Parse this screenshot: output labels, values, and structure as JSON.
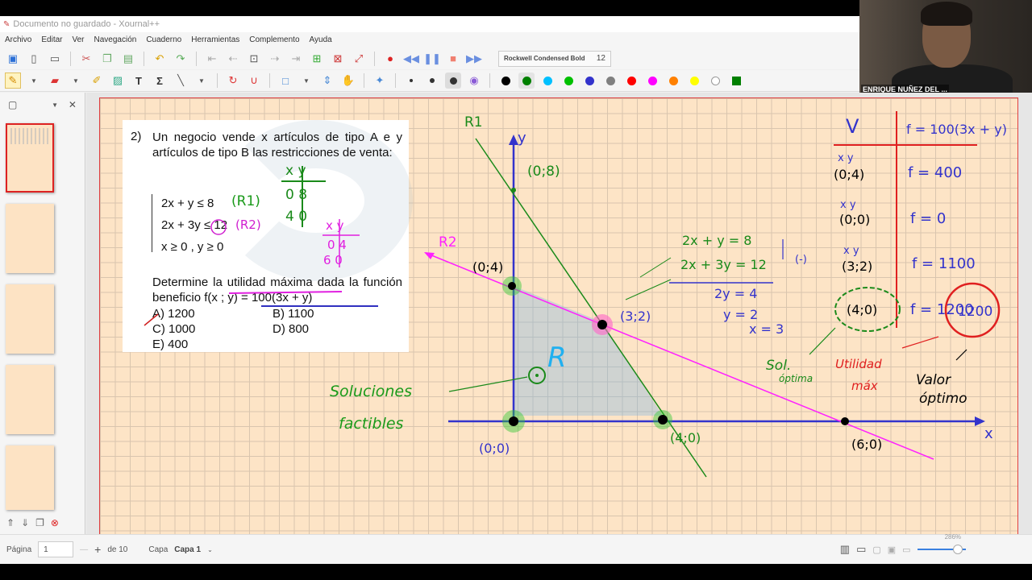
{
  "window": {
    "title": "Documento no guardado - Xournal++"
  },
  "menu": [
    "Archivo",
    "Editar",
    "Ver",
    "Navegación",
    "Cuaderno",
    "Herramientas",
    "Complemento",
    "Ayuda"
  ],
  "toolbar": {
    "font_name": "Rockwell Condensed Bold",
    "font_size": "12"
  },
  "palette": [
    "#000000",
    "#008000",
    "#00c0ff",
    "#00c000",
    "#3333cc",
    "#808080",
    "#ff0000",
    "#ff00ff",
    "#ff8000",
    "#ffff00",
    "#ffffff",
    "#008000"
  ],
  "webcam": {
    "name": "ENRIQUE NUÑEZ DEL ..."
  },
  "problem": {
    "number": "2)",
    "statement": "Un negocio vende x artículos de tipo A e y artículos de tipo B las restricciones de venta:",
    "c1": "2x + y ≤ 8",
    "c2": "2x + 3y ≤ 12",
    "c3": "x ≥ 0 , y ≥ 0",
    "question": "Determine la utilidad máxima dada la función beneficio f(x ; y) = 100(3x + y)",
    "opt_a": "A) 1200",
    "opt_b": "B) 1100",
    "opt_c": "C) 1000",
    "opt_d": "D) 800",
    "opt_e": "E) 400"
  },
  "notes": {
    "r1_label": "R1",
    "r2_label": "R2",
    "r1_tag": "(R1)",
    "r2_tag": "(R2)",
    "y_axis": "y",
    "x_axis": "x",
    "t1_head": "x  y",
    "t1_r1": "0  8",
    "t1_r2": "4  0",
    "t2_head": "x  y",
    "t2_r1": "0  4",
    "t2_r2": "6  0",
    "p08": "(0;8)",
    "p04": "(0;4)",
    "p32": "(3;2)",
    "p00": "(0;0)",
    "p40": "(4;0)",
    "p60": "(6;0)",
    "region": "R",
    "feasible1": "Soluciones",
    "feasible2": "factibles",
    "eq1": "2x + y = 8",
    "eq2": "2x + 3y = 12",
    "eq_op": "(-)",
    "eq3": "2y = 4",
    "eq4": "y = 2",
    "eq5": "x = 3",
    "sol1": "Sol.",
    "sol2": "óptima",
    "util1": "Utilidad",
    "util2": "máx",
    "valor1": "Valor",
    "valor2": "óptimo",
    "tbl_v": "V",
    "tbl_f": "f = 100(3x + y)",
    "v_rows": [
      {
        "xy": "x  y",
        "pt": "(0;4)",
        "f": "f = 400"
      },
      {
        "xy": "x  y",
        "pt": "(0;0)",
        "f": "f = 0"
      },
      {
        "xy": "x  y",
        "pt": "(3;2)",
        "f": "f = 1100"
      },
      {
        "xy": "",
        "pt": "(4;0)",
        "f": "f = 1200"
      }
    ],
    "max_value": "1200"
  },
  "status": {
    "page_label": "Página",
    "page_value": "1",
    "of_label": "de 10",
    "layer_label": "Capa",
    "layer_value": "Capa 1",
    "zoom": "286%"
  }
}
